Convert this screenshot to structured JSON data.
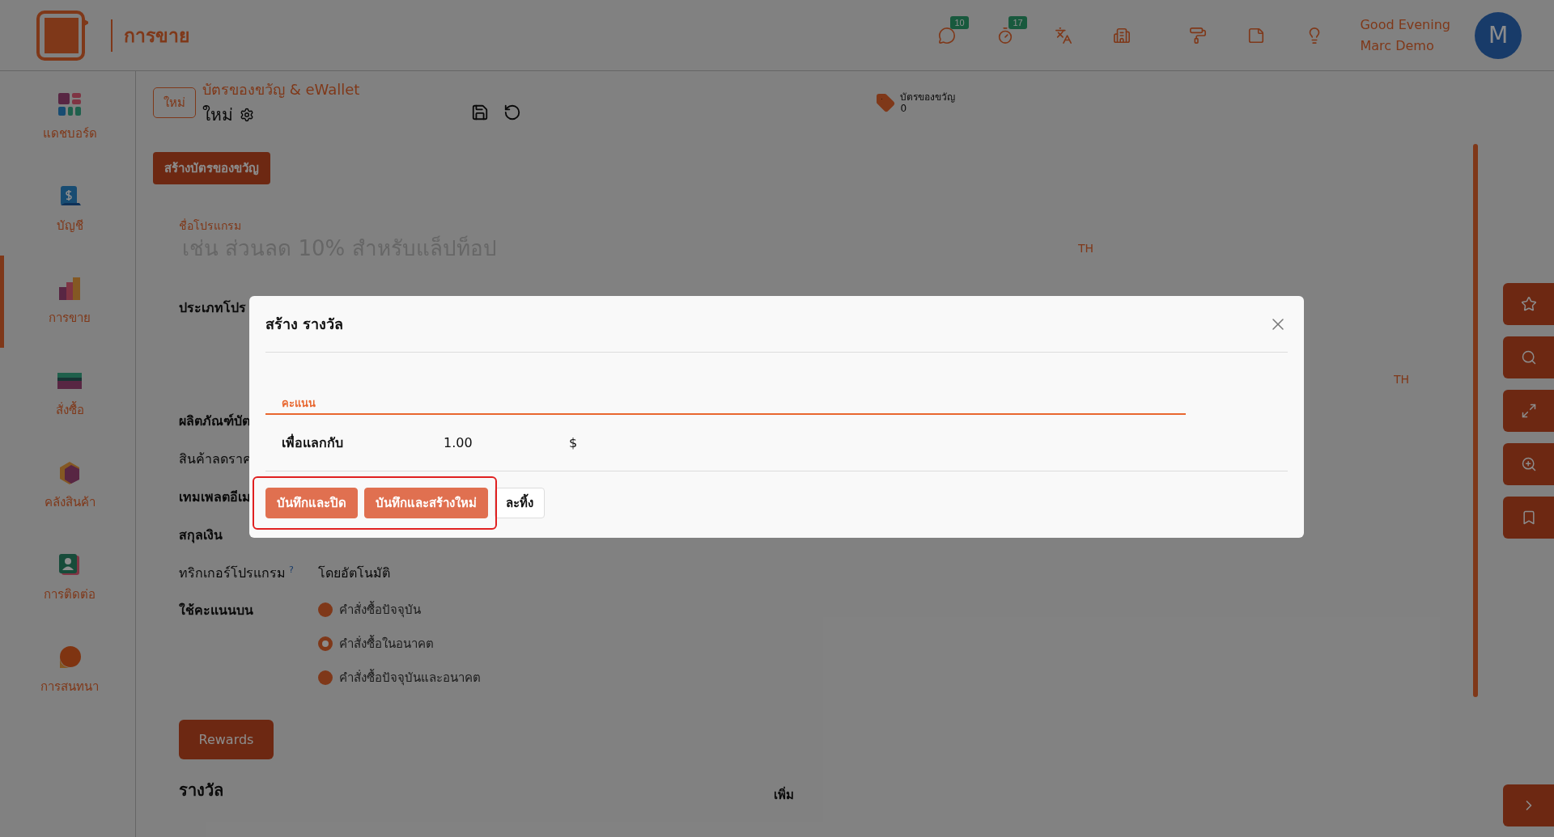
{
  "header": {
    "app_title": "การขาย",
    "actions": [
      {
        "kind": "chat",
        "badge": "10"
      },
      {
        "kind": "timer",
        "badge": "17"
      },
      {
        "kind": "translate"
      },
      {
        "kind": "building"
      },
      {
        "kind": "paint"
      },
      {
        "kind": "note"
      },
      {
        "kind": "bulb"
      }
    ],
    "greeting": "Good Evening",
    "user_name": "Marc Demo",
    "avatar": "M"
  },
  "sidebar": {
    "items": [
      {
        "kind": "dashboard",
        "label": "แดชบอร์ด",
        "selected": false
      },
      {
        "kind": "accounting",
        "label": "บัญชี",
        "selected": false
      },
      {
        "kind": "sales",
        "label": "การขาย",
        "selected": true
      },
      {
        "kind": "purchase",
        "label": "สั่งซื้อ",
        "selected": false
      },
      {
        "kind": "inventory",
        "label": "คลังสินค้า",
        "selected": false
      },
      {
        "kind": "contacts",
        "label": "การติดต่อ",
        "selected": false
      },
      {
        "kind": "chat",
        "label": "การสนทนา",
        "selected": false
      }
    ]
  },
  "breadcrumb": {
    "badge": "ใหม่",
    "parent": "บัตรของขวัญ & eWallet",
    "current": "ใหม่"
  },
  "stat": {
    "label": "บัตรของขวัญ",
    "value": "0"
  },
  "create_button": "สร้างบัตรของขวัญ",
  "form": {
    "name_label": "ชื่อโปรแกรม",
    "name_placeholder": "เช่น ส่วนลด 10% สำหรับแล็ปท็อป",
    "lang_tags": [
      "TH",
      "TH"
    ],
    "fields": [
      {
        "label": "ประเภทโปร",
        "kind": "bold"
      },
      {
        "label": "ผลิตภัณฑ์บัต",
        "kind": "bold"
      },
      {
        "label": "สินค้าลดราค",
        "kind": "plain"
      },
      {
        "label": "เทมเพลตอีเม",
        "kind": "bold"
      },
      {
        "label": "สกุลเงิน",
        "kind": "bold"
      }
    ],
    "trigger": {
      "label": "ทริกเกอร์โปรแกรม",
      "help": "?",
      "value": "โดยอัตโนมัติ"
    },
    "apply_on": {
      "label": "ใช้คะแนนบน",
      "options": [
        {
          "label": "คำสั่งซื้อปัจจุบัน",
          "selected": false
        },
        {
          "label": "คำสั่งซื้อในอนาคต",
          "selected": true
        },
        {
          "label": "คำสั่งซื้อปัจจุบันและอนาคต",
          "selected": false
        }
      ]
    }
  },
  "rewards_button": "Rewards",
  "rewards_title": "รางวัล",
  "add_link": "เพิ่ม",
  "tools": [
    {
      "kind": "star"
    },
    {
      "kind": "search"
    },
    {
      "kind": "expand"
    },
    {
      "kind": "zoom"
    },
    {
      "kind": "bookmark"
    }
  ],
  "modal": {
    "title": "สร้าง รางวัล",
    "tab": "คะแนน",
    "row": {
      "label": "เพื่อแลกกับ",
      "value": "1.00",
      "currency": "$"
    },
    "buttons": [
      {
        "label": "บันทึกและปิด",
        "kind": "primary"
      },
      {
        "label": "บันทึกและสร้างใหม่",
        "kind": "primary"
      },
      {
        "label": "ละทิ้ง",
        "kind": "secondary"
      }
    ]
  }
}
